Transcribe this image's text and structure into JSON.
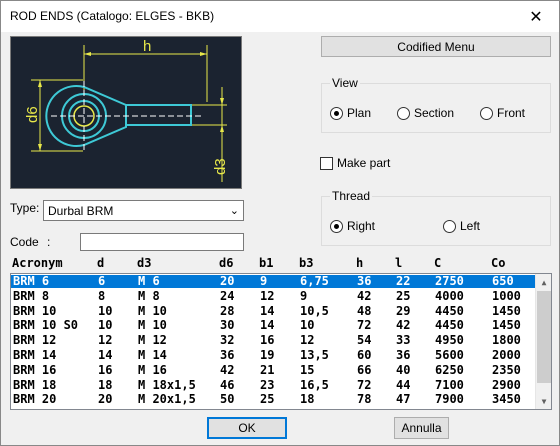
{
  "window": {
    "title": "ROD ENDS (Catalogo: ELGES - BKB)",
    "close_glyph": "✕"
  },
  "preview": {
    "dim_h": "h",
    "dim_d6": "d6",
    "dim_d3": "d3"
  },
  "codified_menu_label": "Codified Menu",
  "view": {
    "label": "View",
    "options": [
      "Plan",
      "Section",
      "Front"
    ],
    "selected": "Plan"
  },
  "make_part": {
    "label": "Make part",
    "checked": false
  },
  "thread": {
    "label": "Thread",
    "options": [
      "Right",
      "Left"
    ],
    "selected": "Right"
  },
  "type": {
    "label": "Type:",
    "value": "Durbal BRM"
  },
  "code": {
    "label": "Code",
    "sep": ":",
    "value": ""
  },
  "table": {
    "columns": [
      "Acronym",
      "d",
      "d3",
      "d6",
      "b1",
      "b3",
      "h",
      "l",
      "C",
      "Co"
    ],
    "rows": [
      [
        "BRM 6",
        "6",
        "M 6",
        "20",
        "9",
        "6,75",
        "36",
        "22",
        "2750",
        "650"
      ],
      [
        "BRM 8",
        "8",
        "M 8",
        "24",
        "12",
        "9",
        "42",
        "25",
        "4000",
        "1000"
      ],
      [
        "BRM 10",
        "10",
        "M 10",
        "28",
        "14",
        "10,5",
        "48",
        "29",
        "4450",
        "1450"
      ],
      [
        "BRM 10 S0",
        "10",
        "M 10",
        "30",
        "14",
        "10",
        "72",
        "42",
        "4450",
        "1450"
      ],
      [
        "BRM 12",
        "12",
        "M 12",
        "32",
        "16",
        "12",
        "54",
        "33",
        "4950",
        "1800"
      ],
      [
        "BRM 14",
        "14",
        "M 14",
        "36",
        "19",
        "13,5",
        "60",
        "36",
        "5600",
        "2000"
      ],
      [
        "BRM 16",
        "16",
        "M 16",
        "42",
        "21",
        "15",
        "66",
        "40",
        "6250",
        "2350"
      ],
      [
        "BRM 18",
        "18",
        "M 18x1,5",
        "46",
        "23",
        "16,5",
        "72",
        "44",
        "7100",
        "2900"
      ],
      [
        "BRM 20",
        "20",
        "M 20x1,5",
        "50",
        "25",
        "18",
        "78",
        "47",
        "7900",
        "3450"
      ]
    ],
    "selected_row": 0
  },
  "ok_label": "OK",
  "cancel_label": "Annulla"
}
